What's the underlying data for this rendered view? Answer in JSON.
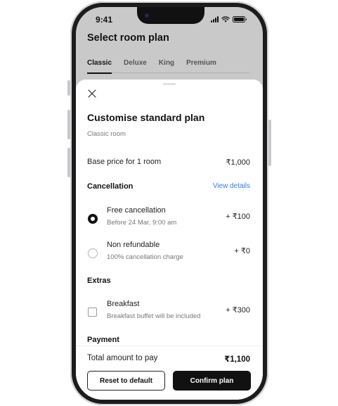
{
  "status_bar": {
    "time": "9:41"
  },
  "background": {
    "title": "Select room plan",
    "tabs": [
      {
        "label": "Classic",
        "active": true
      },
      {
        "label": "Deluxe",
        "active": false
      },
      {
        "label": "King",
        "active": false
      },
      {
        "label": "Premium",
        "active": false
      }
    ]
  },
  "sheet": {
    "title": "Customise standard plan",
    "subtitle": "Classic room",
    "base_price": {
      "label": "Base price for 1 room",
      "value": "₹1,000"
    },
    "cancellation": {
      "heading": "Cancellation",
      "link": "View details",
      "options": [
        {
          "title": "Free cancellation",
          "detail": "Before 24 Mar, 9:00 am",
          "price": "+ ₹100",
          "selected": true
        },
        {
          "title": "Non refundable",
          "detail": "100% cancellation charge",
          "price": "+ ₹0",
          "selected": false
        }
      ]
    },
    "extras": {
      "heading": "Extras",
      "items": [
        {
          "title": "Breakfast",
          "detail": "Breakfast buffet will be included",
          "price": "+ ₹300",
          "checked": false
        }
      ]
    },
    "payment": {
      "heading": "Payment"
    },
    "footer": {
      "total_label": "Total amount to pay",
      "total_value": "₹1,100",
      "reset_label": "Reset to default",
      "confirm_label": "Confirm plan"
    }
  },
  "colors": {
    "accent_link": "#2f80e0",
    "primary_button": "#111111",
    "backdrop": "#c9c9c9"
  }
}
